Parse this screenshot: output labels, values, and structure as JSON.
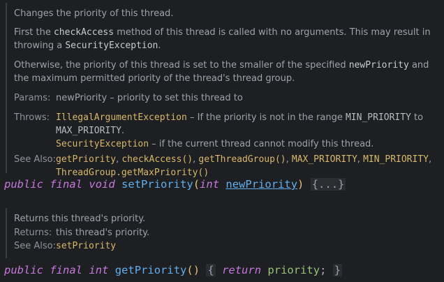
{
  "doc1": {
    "summary": "Changes the priority of this thread.",
    "p2_a": "First the ",
    "p2_code1": "checkAccess",
    "p2_b": " method of this thread is called with no arguments. This may result in throwing a ",
    "p2_code2": "SecurityException",
    "p2_c": ".",
    "p3_a": "Otherwise, the priority of this thread is set to the smaller of the specified ",
    "p3_code1": "newPriority",
    "p3_b": " and the maximum permitted priority of the thread's thread group.",
    "params_label": "Params:",
    "params_text": "newPriority – priority to set this thread to",
    "throws_label": "Throws:",
    "throws1_ref": "IllegalArgumentException",
    "throws1_a": " – If the priority is not in the range ",
    "throws1_min": "MIN_PRIORITY",
    "throws1_b": " to ",
    "throws1_max": "MAX_PRIORITY",
    "throws1_c": ".",
    "throws2_ref": "SecurityException",
    "throws2_text": " – if the current thread cannot modify this thread.",
    "seealso_label": "See Also:",
    "seealso": [
      "getPriority",
      "checkAccess()",
      "getThreadGroup()",
      "MAX_PRIORITY",
      "MIN_PRIORITY",
      "ThreadGroup.getMaxPriority()"
    ],
    "sep": ", "
  },
  "code1": {
    "kw_public": "public",
    "kw_final": "final",
    "type": "void",
    "name": "setPriority",
    "open": "(",
    "param_type": "int",
    "param_name": "newPriority",
    "close": ")",
    "fold": "{...}"
  },
  "doc2": {
    "summary": "Returns this thread's priority.",
    "returns_label": "Returns:",
    "returns_text": "this thread's priority.",
    "seealso_label": "See Also:",
    "seealso_ref": "setPriority"
  },
  "code2": {
    "kw_public": "public",
    "kw_final": "final",
    "type": "int",
    "name": "getPriority",
    "parens": "()",
    "open_brace": "{",
    "kw_return": "return",
    "field": "priority",
    "semicolon": ";",
    "close_brace": "}"
  },
  "colors": {
    "background": "#1e1f22",
    "keyword": "#c679dd",
    "method": "#61afef",
    "reference": "#d8b86a",
    "field": "#98c379"
  }
}
